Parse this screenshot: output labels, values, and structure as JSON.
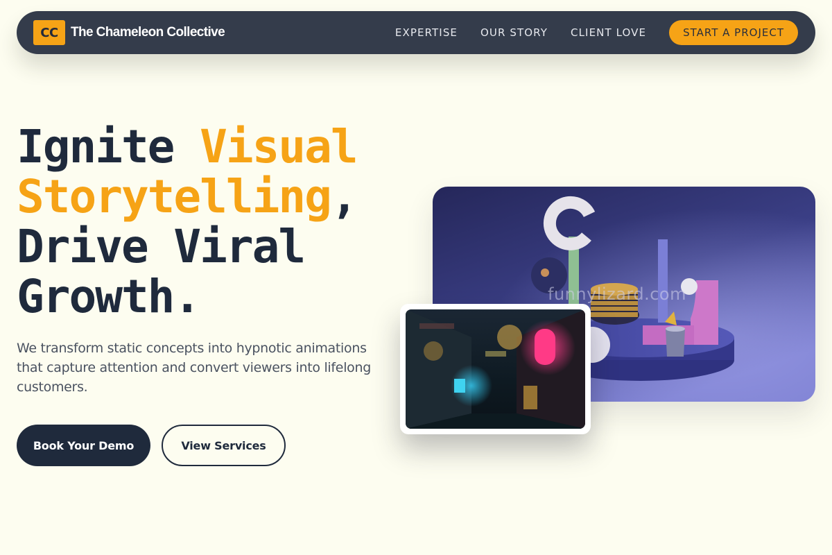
{
  "nav": {
    "logo_mark": "CC",
    "brand": "The Chameleon Collective",
    "links": [
      {
        "label": "EXPERTISE"
      },
      {
        "label": "OUR STORY"
      },
      {
        "label": "CLIENT LOVE"
      }
    ],
    "cta_label": "START A PROJECT"
  },
  "hero": {
    "headline": {
      "part1": "Ignite ",
      "accent1": "Visual",
      "accent2": "Storytelling",
      "part2": ",",
      "line3": "Drive Viral",
      "line4": "Growth."
    },
    "subtext": "We transform static concepts into hypnotic animations that capture attention and convert viewers into lifelong customers.",
    "primary_button": "Book Your Demo",
    "secondary_button": "View Services"
  },
  "media": {
    "watermark": "funnylizard.com",
    "main_image_desc": "3d-abstract-shapes-image",
    "thumb_image_desc": "neon-alley-image"
  },
  "colors": {
    "background": "#fdfdf0",
    "nav_bg": "#343c4b",
    "accent": "#f6a316",
    "dark_text": "#1f2a3c",
    "body_text": "#4a5260"
  }
}
